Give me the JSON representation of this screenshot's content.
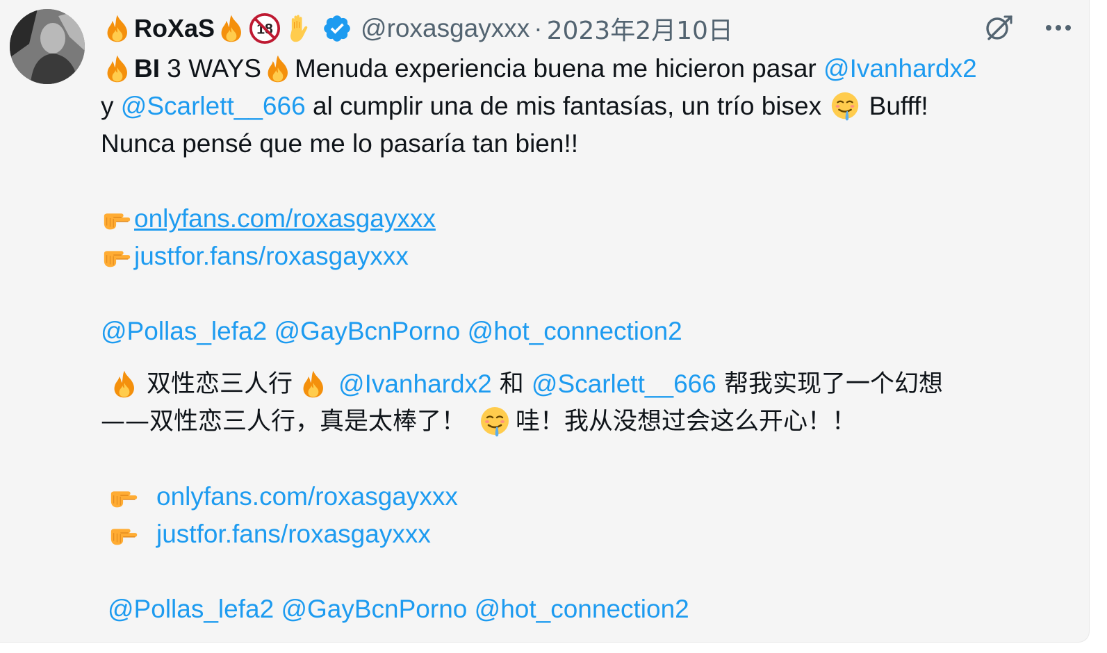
{
  "user": {
    "display_name": "RoXaS",
    "handle": "@roxasgayxxx",
    "date": "2023年2月10日",
    "badge_18_label": "18"
  },
  "icons": {
    "avatar": "profile-photo",
    "fire": "fire-icon",
    "raised_hand": "raised-hand-icon",
    "no_under_18": "no-under-18-icon",
    "verified": "verified-badge-icon",
    "grok": "grok-icon",
    "more": "more-options-icon",
    "pointing": "pointing-right-icon",
    "drooling": "drooling-face-icon"
  },
  "colors": {
    "link": "#1d9bf0",
    "text": "#0f1419",
    "secondary": "#536471",
    "card_bg": "#f5f5f5"
  },
  "tweet": {
    "line1_bold": "BI",
    "line1_a": " 3 WAYS",
    "line1_b": "Menuda experiencia buena me hicieron pasar ",
    "mention_ivan": "@Ivanhardx2",
    "line2_a": "y ",
    "mention_scarlett": "@Scarlett__666",
    "line2_b": " al cumplir una de mis fantasías, un trío bisex ",
    "line2_c": " Bufff!",
    "line3": "Nunca pensé que me lo pasaría tan bien!!",
    "link_onlyfans": "onlyfans.com/roxasgayxxx",
    "link_justfor": "justfor.fans/roxasgayxxx",
    "mention_pollas": "@Pollas_lefa2",
    "mention_gaybcn": "@GayBcnPorno",
    "mention_hot": "@hot_connection2",
    "cn_a": "双性恋三人行",
    "cn_mention_ivan": "@Ivanhardx2",
    "cn_and": " 和 ",
    "cn_mention_scarlett": "@Scarlett__666",
    "cn_b": " 帮我实现了一个幻想",
    "cn_c": "——双性恋三人行，真是太棒了！",
    "cn_d": "哇！我从没想过会这么开心！！",
    "cn_link_onlyfans": "onlyfans.com/roxasgayxxx",
    "cn_link_justfor": "justfor.fans/roxasgayxxx",
    "cn_mention_pollas": "@Pollas_lefa2",
    "cn_mention_gaybcn": "@GayBcnPorno",
    "cn_mention_hot": "@hot_connection2"
  }
}
